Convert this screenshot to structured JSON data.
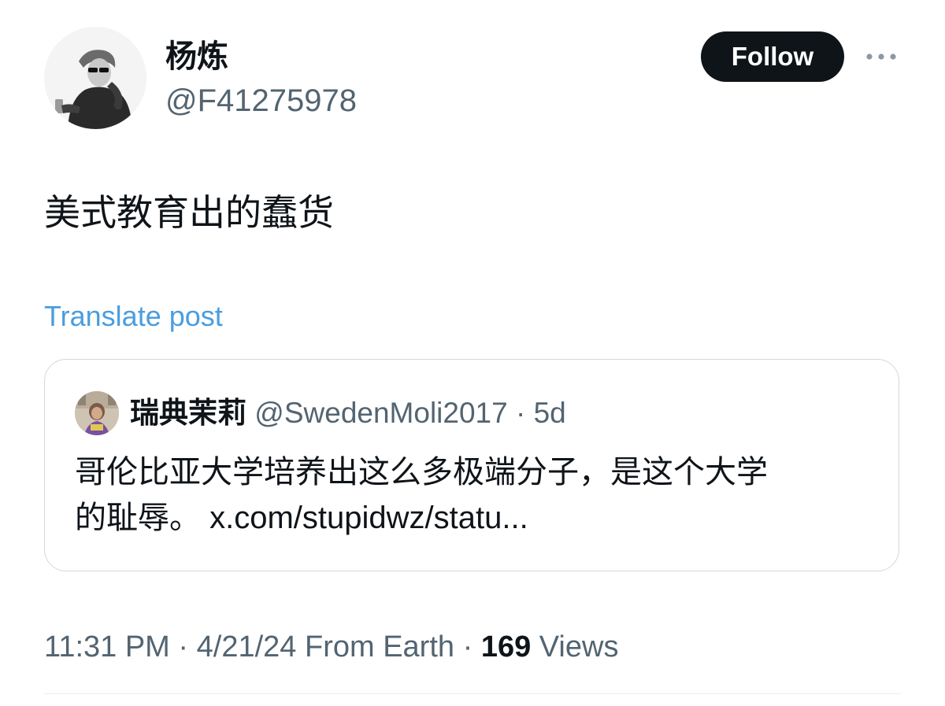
{
  "author": {
    "display_name": "杨炼",
    "handle": "@F41275978"
  },
  "actions": {
    "follow_label": "Follow",
    "more_icon": "more-horizontal-icon"
  },
  "post": {
    "text": "美式教育出的蠢货",
    "translate_label": "Translate post"
  },
  "quoted_post": {
    "display_name": "瑞典茉莉",
    "handle": "@SwedenMoli2017",
    "separator": " · ",
    "time": "5d",
    "text_line1": "哥伦比亚大学培养出这么多极端分子，是这个大学",
    "text_line2": "的耻辱。",
    "link": "x.com/stupidwz/statu..."
  },
  "meta": {
    "time": "11:31 PM",
    "separator1": " · ",
    "date": "4/21/24",
    "location": " From Earth",
    "separator2": " · ",
    "views_count": "169",
    "views_label": " Views"
  },
  "colors": {
    "text_primary": "#0f1419",
    "text_secondary": "#536471",
    "link_blue": "#4a9de0",
    "border": "#cfd9de",
    "button_bg": "#0f1419"
  }
}
